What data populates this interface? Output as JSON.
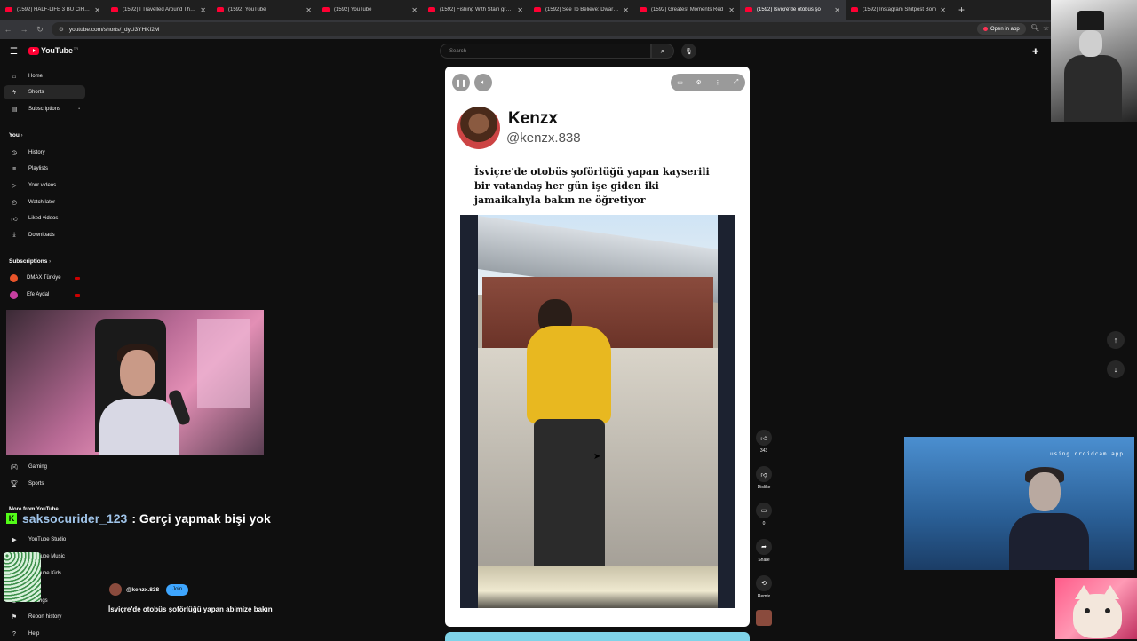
{
  "tabs": [
    {
      "label": "(1592) HALF-LIFE 3 BU CİHAZA",
      "active": false
    },
    {
      "label": "(1592) I Travelled Around The W",
      "active": false
    },
    {
      "label": "(1592) YouTube",
      "active": false
    },
    {
      "label": "(1592) YouTube",
      "active": false
    },
    {
      "label": "(1592) Fishing With Stain group",
      "active": false
    },
    {
      "label": "(1592) See To Believe: Dwarf Gi",
      "active": false
    },
    {
      "label": "(1592) Greatest Moments Red",
      "active": false
    },
    {
      "label": "(1592) İsviçre'de otobüs şo",
      "active": true
    },
    {
      "label": "(1592) İnstagram Shitpost Bom",
      "active": false
    }
  ],
  "address": {
    "url": "youtube.com/shorts/_dyU3YHKf2M",
    "open_in_app": "Open in app"
  },
  "header": {
    "logo": "YouTube",
    "logo_country": "TR",
    "search_placeholder": "Search"
  },
  "sidebar": {
    "main": [
      {
        "label": "Home",
        "icon": "home-icon"
      },
      {
        "label": "Shorts",
        "icon": "shorts-icon",
        "active": true
      },
      {
        "label": "Subscriptions",
        "icon": "subscriptions-icon"
      }
    ],
    "you_title": "You",
    "you": [
      {
        "label": "History",
        "icon": "history-icon"
      },
      {
        "label": "Playlists",
        "icon": "playlists-icon"
      },
      {
        "label": "Your videos",
        "icon": "your-videos-icon"
      },
      {
        "label": "Watch later",
        "icon": "watch-later-icon"
      },
      {
        "label": "Liked videos",
        "icon": "liked-icon"
      },
      {
        "label": "Downloads",
        "icon": "download-icon"
      }
    ],
    "subs_title": "Subscriptions",
    "subs": [
      {
        "label": "DMAX Türkiye",
        "color": "#e8542a"
      },
      {
        "label": "Efe Aydal",
        "color": "#c63fa0"
      }
    ],
    "explore": [
      {
        "label": "Gaming",
        "icon": "gaming-icon"
      },
      {
        "label": "Sports",
        "icon": "sports-icon"
      }
    ],
    "more_title": "More from YouTube",
    "more": [
      {
        "label": "YouTube Studio",
        "icon": "studio-icon"
      },
      {
        "label": "YouTube Music",
        "icon": "music-icon"
      },
      {
        "label": "YouTube Kids",
        "icon": "kids-icon"
      }
    ],
    "footer": [
      {
        "label": "Settings",
        "icon": "settings-icon"
      },
      {
        "label": "Report history",
        "icon": "report-icon"
      },
      {
        "label": "Help",
        "icon": "help-icon"
      }
    ]
  },
  "chat": {
    "user": "saksocurider_123",
    "separator": ":",
    "message": "Gerçi yapmak bişi yok"
  },
  "short": {
    "tweet_name": "Kenzx",
    "tweet_handle": "@kenzx.838",
    "caption": "İsviçre'de otobüs şoförlüğü yapan kayserili bir vatandaş her gün işe giden iki jamaikalıyla bakın ne öğretiyor",
    "uploader": "@kenzx.838",
    "join_label": "Join",
    "title": "İsviçre'de otobüs şoförlüğü yapan abimize bakın"
  },
  "actions": {
    "likes": "343",
    "dislike_label": "Dislike",
    "comments": "0",
    "share_label": "Share",
    "remix_label": "Remix"
  },
  "overlay": {
    "droidcam": "using droidcam.app"
  },
  "colors": {
    "accent": "#ff0033",
    "join": "#3ea6ff",
    "bg": "#0f0f0f"
  }
}
